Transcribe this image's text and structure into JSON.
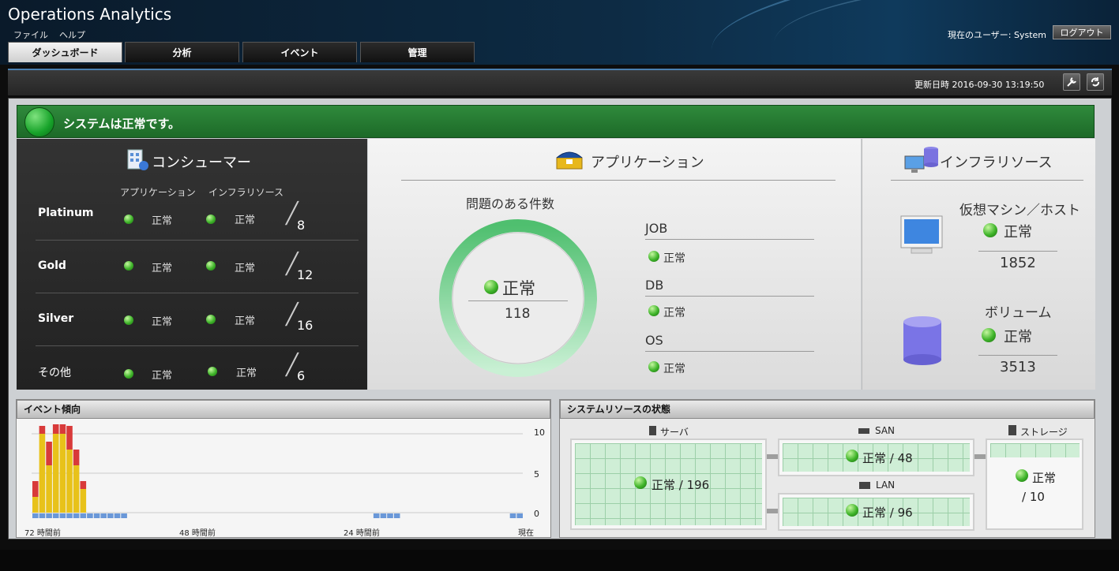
{
  "header": {
    "title": "Operations Analytics",
    "menu": {
      "file": "ファイル",
      "help": "ヘルプ"
    },
    "tabs": [
      {
        "label": "ダッシュボード",
        "active": true
      },
      {
        "label": "分析",
        "active": false
      },
      {
        "label": "イベント",
        "active": false
      },
      {
        "label": "管理",
        "active": false
      }
    ],
    "current_user": "現在のユーザー: System",
    "logout": "ログアウト"
  },
  "toolbar": {
    "updated": "更新日時 2016-09-30 13:19:50",
    "icons": [
      "wrench-icon",
      "refresh-icon"
    ]
  },
  "status": {
    "text": "システムは正常です。",
    "color": "#1f7a2c"
  },
  "consumer": {
    "title": "コンシューマー",
    "col_app": "アプリケーション",
    "col_infra": "インフラリソース",
    "rows": [
      {
        "name": "Platinum",
        "app": "正常",
        "infra": "正常",
        "count": "8"
      },
      {
        "name": "Gold",
        "app": "正常",
        "infra": "正常",
        "count": "12"
      },
      {
        "name": "Silver",
        "app": "正常",
        "infra": "正常",
        "count": "16"
      },
      {
        "name": "その他",
        "app": "正常",
        "infra": "正常",
        "count": "6"
      }
    ]
  },
  "application": {
    "title": "アプリケーション",
    "problem_label": "問題のある件数",
    "ring_status": "正常",
    "ring_count": "118",
    "items": [
      {
        "name": "JOB",
        "status": "正常"
      },
      {
        "name": "DB",
        "status": "正常"
      },
      {
        "name": "OS",
        "status": "正常"
      }
    ]
  },
  "infra": {
    "title": "インフラリソース",
    "vm_label": "仮想マシン／ホスト",
    "vm_status": "正常",
    "vm_count": "1852",
    "vol_label": "ボリューム",
    "vol_status": "正常",
    "vol_count": "3513"
  },
  "event_trend": {
    "title": "イベント傾向",
    "y_ticks": [
      "10",
      "5",
      "0"
    ],
    "x_labels": [
      "72 時間前",
      "48 時間前",
      "24 時間前",
      "現在"
    ]
  },
  "chart_data": {
    "type": "bar",
    "ylim": [
      0,
      10
    ],
    "series": [
      {
        "color": "#e8c21a",
        "values": [
          2,
          10,
          6,
          10,
          10,
          8,
          6,
          3,
          0,
          0,
          0,
          0,
          0,
          0,
          0,
          0,
          0,
          0,
          0,
          0,
          0,
          0,
          0,
          0,
          0,
          0,
          0,
          0,
          0,
          0,
          0,
          0,
          0,
          0,
          0,
          0,
          0,
          0,
          0,
          0,
          0,
          0,
          0,
          0,
          0,
          0,
          0,
          0,
          0,
          0,
          0,
          0,
          0,
          0,
          0,
          0,
          0,
          0,
          0,
          0,
          0,
          0,
          0,
          0,
          0,
          0,
          0,
          0,
          0,
          0,
          0,
          0
        ]
      },
      {
        "color": "#d83a3a",
        "values": [
          2,
          1,
          3,
          4,
          3,
          3,
          2,
          1,
          0,
          0,
          0,
          0,
          0,
          0,
          0,
          0,
          0,
          0,
          0,
          0,
          0,
          0,
          0,
          0,
          0,
          0,
          0,
          0,
          0,
          0,
          0,
          0,
          0,
          0,
          0,
          0,
          0,
          0,
          0,
          0,
          0,
          0,
          0,
          0,
          0,
          0,
          0,
          0,
          0,
          0,
          0,
          0,
          0,
          0,
          0,
          0,
          0,
          0,
          0,
          0,
          0,
          0,
          0,
          0,
          0,
          0,
          0,
          0,
          0,
          0,
          0,
          0
        ]
      },
      {
        "color": "#6a98d8",
        "values": [
          1,
          1,
          1,
          1,
          1,
          1,
          1,
          1,
          1,
          1,
          1,
          1,
          1,
          1,
          0,
          0,
          0,
          0,
          0,
          0,
          0,
          0,
          0,
          0,
          0,
          0,
          0,
          0,
          0,
          0,
          0,
          0,
          0,
          0,
          0,
          0,
          0,
          0,
          0,
          0,
          0,
          0,
          0,
          0,
          0,
          0,
          0,
          0,
          0,
          0,
          1,
          1,
          1,
          1,
          0,
          0,
          0,
          0,
          0,
          0,
          0,
          0,
          0,
          0,
          0,
          0,
          0,
          0,
          0,
          0,
          1,
          1
        ]
      }
    ]
  },
  "resources": {
    "title": "システムリソースの状態",
    "server": {
      "label": "サーバ",
      "status": "正常 / 196"
    },
    "san": {
      "label": "SAN",
      "status": "正常 / 48"
    },
    "lan": {
      "label": "LAN",
      "status": "正常 / 96"
    },
    "storage": {
      "label": "ストレージ",
      "status": "正常",
      "count": "/ 10"
    }
  }
}
